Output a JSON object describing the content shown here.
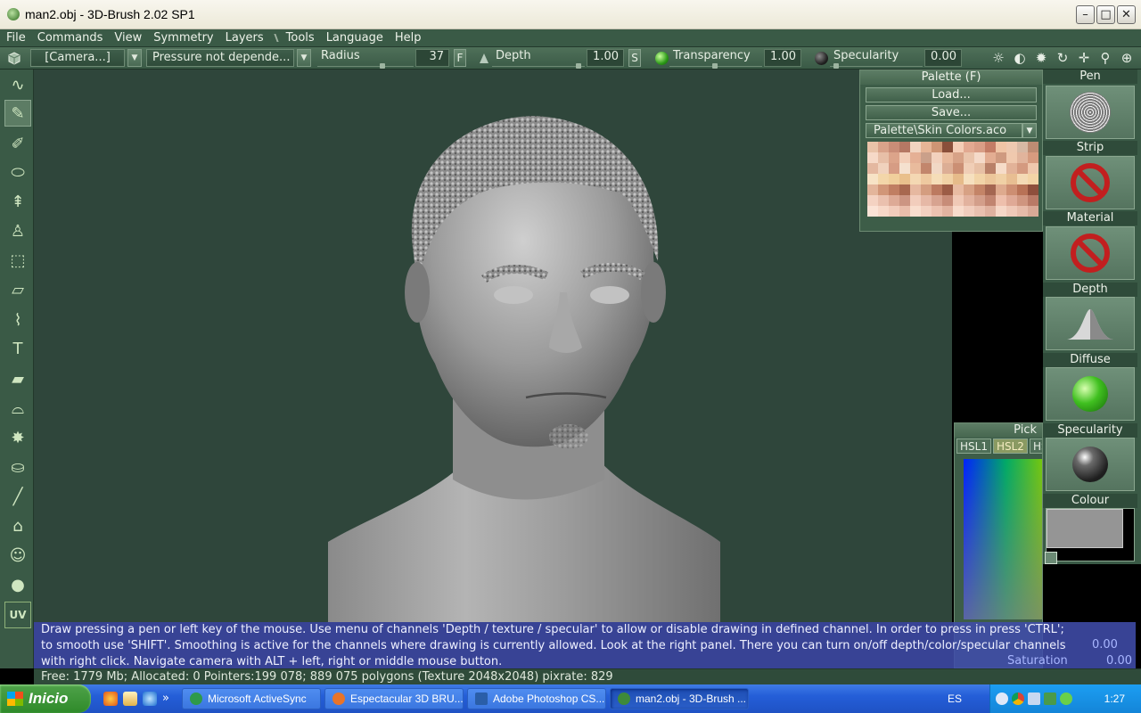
{
  "window": {
    "title": "man2.obj - 3D-Brush 2.02 SP1",
    "minimize": "–",
    "maximize": "□",
    "close": "✕"
  },
  "menu": [
    "File",
    "Commands",
    "View",
    "Symmetry",
    "Layers",
    "Tools",
    "Language",
    "Help"
  ],
  "toolbar": {
    "camera": "[Camera...]",
    "pressure": "Pressure not depende...",
    "radius_label": "Radius",
    "radius_value": "37",
    "f_button": "F",
    "depth_label": "Depth",
    "depth_value": "1.00",
    "s_button": "S",
    "transparency_label": "Transparency",
    "transparency_value": "1.00",
    "specularity_label": "Specularity",
    "specularity_value": "0.00"
  },
  "palette": {
    "title": "Palette (F)",
    "load": "Load...",
    "save": "Save...",
    "file": "Palette\\Skin Colors.aco",
    "colors": [
      "#e9c3a8",
      "#d9a38a",
      "#c98d77",
      "#b57864",
      "#f1d4c0",
      "#e6b596",
      "#ce9574",
      "#8a4f3a",
      "#f4cdb6",
      "#e2a991",
      "#d99e86",
      "#c47d66",
      "#f0c5a6",
      "#eec9b0",
      "#d7b9a4",
      "#bd8c73",
      "#f6d9c7",
      "#e7bfa7",
      "#dca48a",
      "#f3cfb9",
      "#e5b095",
      "#caa08a",
      "#f2d1bd",
      "#e8b89b",
      "#d7a287",
      "#eac4ab",
      "#f5dac9",
      "#e3ad92",
      "#cf9a80",
      "#f0c9ae",
      "#e1b49c",
      "#d69b7f",
      "#e4b8a0",
      "#f0d2bd",
      "#d69c84",
      "#f5e1cf",
      "#e9bb9d",
      "#c2866c",
      "#f1d8c5",
      "#dcae95",
      "#cb8f74",
      "#f0ceb6",
      "#e7c0a5",
      "#b98068",
      "#f6dcc9",
      "#e2b298",
      "#d49a80",
      "#efc8ad",
      "#f7e3c6",
      "#f3d6a9",
      "#f0cf9c",
      "#e9c08c",
      "#f4d8b3",
      "#eec9a0",
      "#f5ddb8",
      "#f1d2a6",
      "#e6bb8a",
      "#f6e0bf",
      "#f2d4a8",
      "#ecc69a",
      "#f0d0a5",
      "#e8be92",
      "#f4dab5",
      "#f3d4a6",
      "#e3b59b",
      "#d19678",
      "#c07e62",
      "#a8684f",
      "#e6b8a0",
      "#d49d80",
      "#bc7a60",
      "#9c5c46",
      "#e8bba2",
      "#d7a184",
      "#c48467",
      "#a46651",
      "#deaa8e",
      "#cd8e72",
      "#b87256",
      "#8e4f3c",
      "#f4d2c2",
      "#eac0ae",
      "#ddaa96",
      "#cc9582",
      "#f2cdbc",
      "#e6b8a6",
      "#d7a390",
      "#c78c78",
      "#f0c9b6",
      "#e2b29e",
      "#d39e8a",
      "#c18470",
      "#eebfac",
      "#dfa996",
      "#cf957f",
      "#b97a66",
      "#fbe3d6",
      "#f7d8c8",
      "#f1ccbb",
      "#e9bdaa",
      "#f9dece",
      "#f3d0c0",
      "#ecc2b0",
      "#e2b3a0",
      "#f8dbcb",
      "#f1cdbd",
      "#e9c0af",
      "#dfb19f",
      "#f6d7c7",
      "#efc9b8",
      "#e6bba9",
      "#d9a996"
    ],
    "channels": [
      {
        "label": "Pen",
        "icon": "pen-stroke-icon"
      },
      {
        "label": "Strip",
        "icon": "disabled-icon"
      },
      {
        "label": "Material",
        "icon": "disabled-icon"
      },
      {
        "label": "Depth",
        "icon": "depth-bump-icon"
      },
      {
        "label": "Diffuse",
        "icon": "green-sphere-icon"
      },
      {
        "label": "Specularity",
        "icon": "dark-sphere-icon"
      },
      {
        "label": "Colour",
        "icon": "grey-swatch-icon"
      }
    ]
  },
  "pick": {
    "title": "Pick",
    "tabs": [
      "HSL1",
      "HSL2",
      "HS"
    ],
    "value_readout": "0.00",
    "saturation_label": "Saturation",
    "saturation_value": "0.00"
  },
  "help_lines": [
    "Draw pressing a pen or left key of the mouse. Use menu of channels 'Depth / texture / specular' to allow or disable drawing in defined channel. In order to press in press 'CTRL';",
    "to smooth use 'SHIFT'. Smoothing is active for the channels where drawing is currently allowed. Look at the right panel. There you can turn on/off depth/color/specular channels",
    "with right click. Navigate camera with ALT + left, right or middle mouse button."
  ],
  "status": "Free: 1779 Mb; Allocated: 0 Pointers:199 078; 889 075 polygons (Texture 2048x2048) pixrate: 829",
  "taskbar": {
    "start": "Inicio",
    "overflow": "»",
    "buttons": [
      {
        "label": "Microsoft ActiveSync",
        "color": "#2e9a4a"
      },
      {
        "label": "Espectacular 3D BRU...",
        "color": "#e8742a"
      },
      {
        "label": "Adobe Photoshop CS...",
        "color": "#2a5ea8"
      },
      {
        "label": "man2.obj - 3D-Brush ...",
        "color": "#3e8a3a",
        "active": true
      }
    ],
    "lang": "ES",
    "clock": "1:27"
  },
  "left_tools": [
    "wave-brush-icon",
    "pen-brush-icon",
    "spray-icon",
    "cylinder-icon",
    "extrude-icon",
    "stamp-icon",
    "marquee-icon",
    "plane-icon",
    "spline-icon",
    "text-tool-icon",
    "eraser-icon",
    "glasses-icon",
    "star-burst-icon",
    "bucket-icon",
    "knife-icon",
    "iron-icon",
    "bust-icon",
    "sphere-icon",
    "uv-icon"
  ],
  "colors": {
    "ui_green": "#3a5a46",
    "viewport": "#2f463b",
    "help_blue": "#404caa",
    "taskbar": "#245ed8"
  }
}
